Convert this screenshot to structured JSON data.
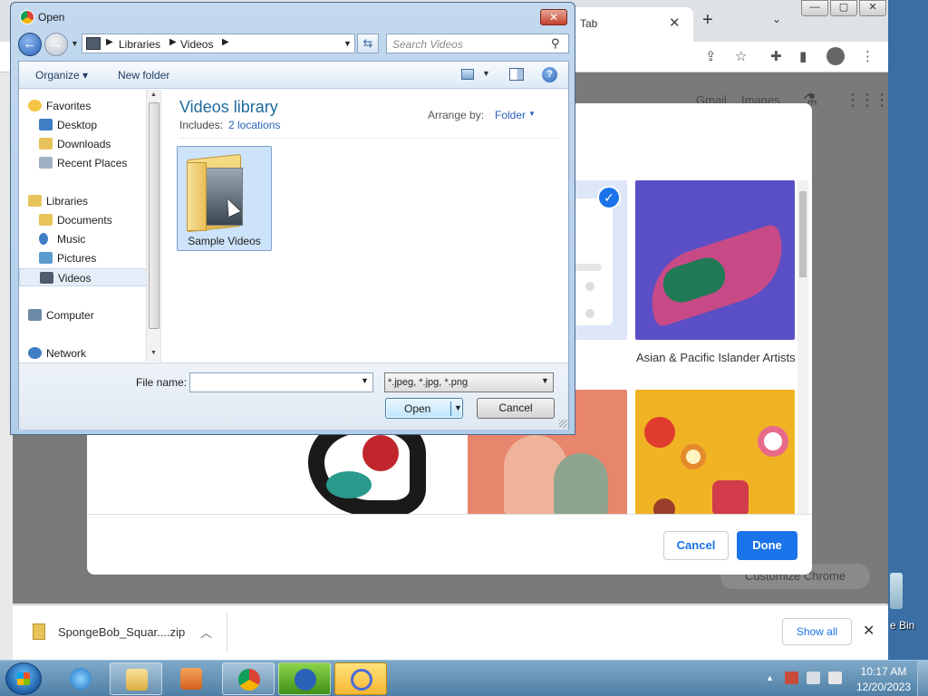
{
  "chrome": {
    "tab_title": "Tab",
    "tab_close": "✕",
    "new_tab": "+",
    "tab_search": "⌄",
    "win_min": "—",
    "win_max": "▢",
    "win_close": "✕",
    "gmail": "Gmail",
    "images": "Images",
    "customize_chrome": "Customize Chrome",
    "modal": {
      "tile_label": "Asian & Pacific Islander Artists",
      "cancel": "Cancel",
      "done": "Done"
    },
    "downloads": {
      "file_name": "SpongeBob_Squar....zip",
      "show_all": "Show all",
      "close": "✕"
    }
  },
  "desktop": {
    "recycle_label": "e Bin"
  },
  "dialog": {
    "title": "Open",
    "close": "✕",
    "back": "←",
    "forward": "→",
    "address": [
      "Libraries",
      "Videos"
    ],
    "search_placeholder": "Search Videos",
    "toolbar": {
      "organize": "Organize ▾",
      "new_folder": "New folder",
      "help": "?"
    },
    "nav": [
      {
        "label": "Favorites",
        "kind": "header"
      },
      {
        "label": "Desktop",
        "kind": "item"
      },
      {
        "label": "Downloads",
        "kind": "item"
      },
      {
        "label": "Recent Places",
        "kind": "item"
      },
      {
        "label": "Libraries",
        "kind": "header"
      },
      {
        "label": "Documents",
        "kind": "item"
      },
      {
        "label": "Music",
        "kind": "item"
      },
      {
        "label": "Pictures",
        "kind": "item"
      },
      {
        "label": "Videos",
        "kind": "item",
        "selected": true
      },
      {
        "label": "Computer",
        "kind": "header"
      },
      {
        "label": "Network",
        "kind": "header"
      }
    ],
    "library_title": "Videos library",
    "includes_label": "Includes:",
    "includes_link": "2 locations",
    "arrange_by": "Arrange by:",
    "arrange_value": "Folder",
    "folder_name": "Sample Videos",
    "file_name_label": "File name:",
    "file_name_value": "",
    "file_type": "*.jpeg, *.jpg, *.png",
    "open": "Open",
    "cancel": "Cancel"
  },
  "taskbar": {
    "time": "10:17 AM",
    "date": "12/20/2023"
  },
  "colors": {
    "accent_blue": "#1a73e8",
    "library_title": "#1e6a9e",
    "link_blue": "#2a62b8"
  }
}
